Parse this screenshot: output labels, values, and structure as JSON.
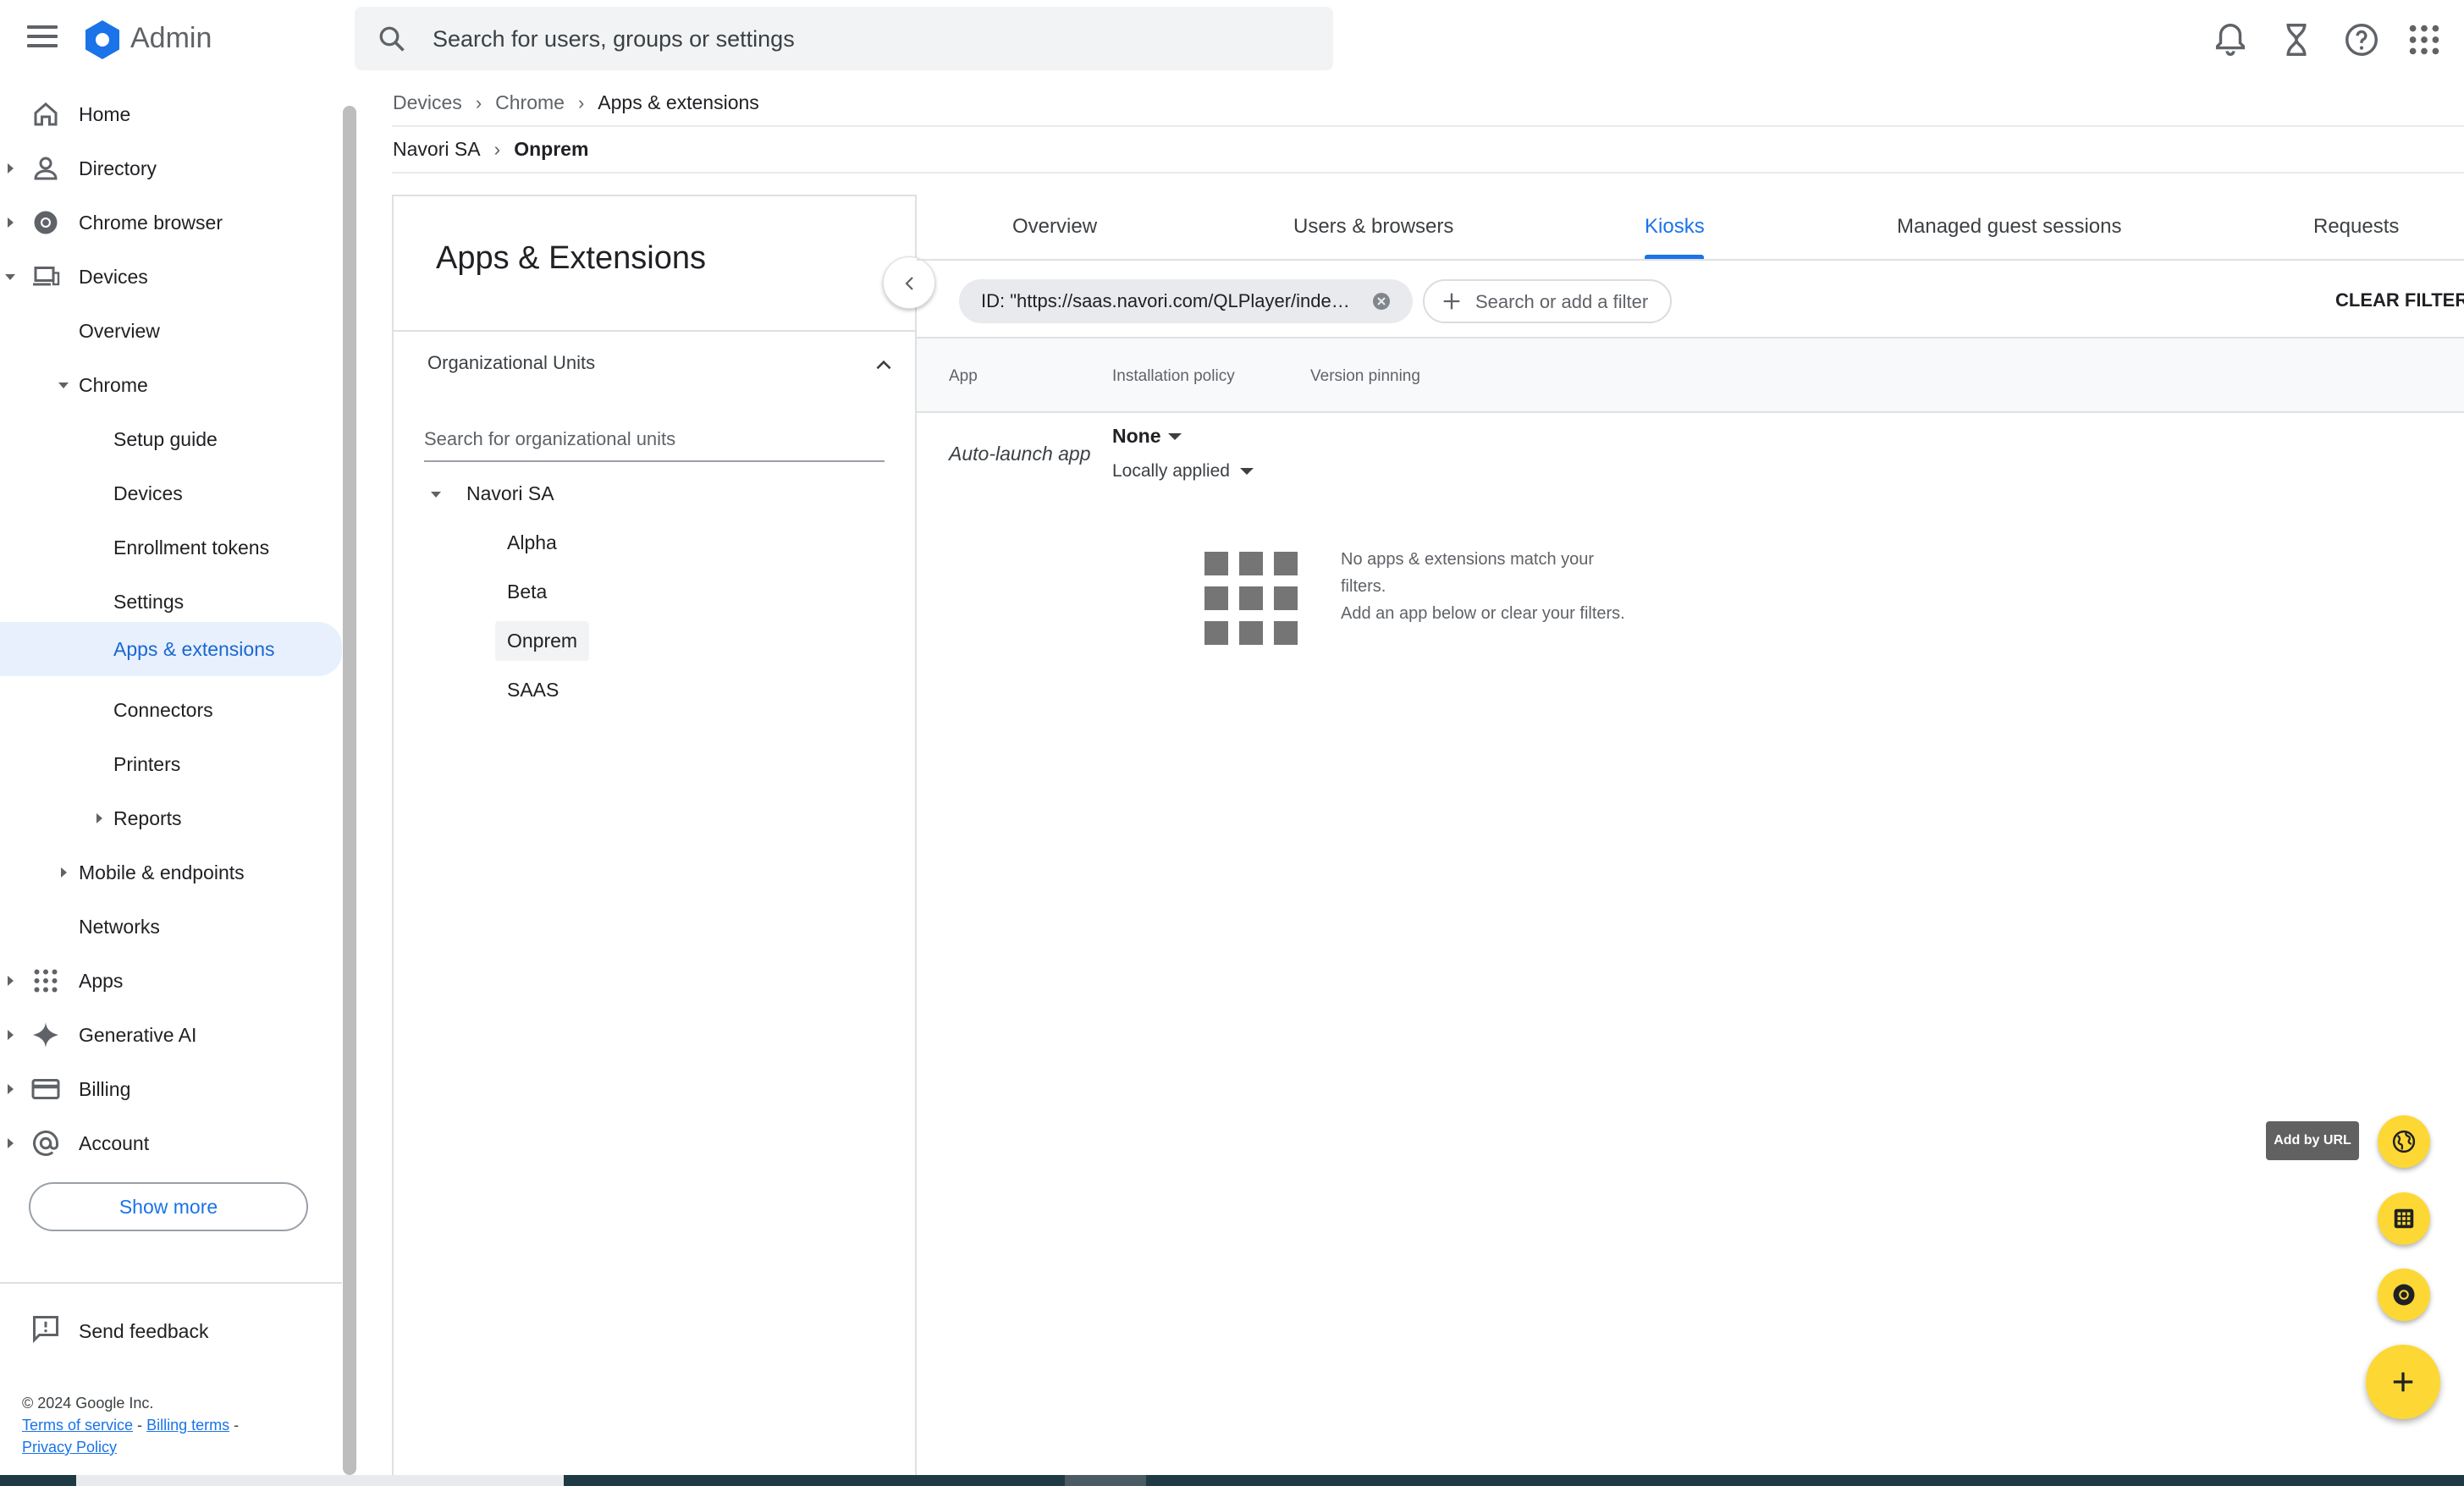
{
  "app": {
    "brand": "Admin",
    "search_placeholder": "Search for users, groups or settings"
  },
  "sidebar": {
    "items": [
      {
        "label": "Home"
      },
      {
        "label": "Directory"
      },
      {
        "label": "Chrome browser"
      },
      {
        "label": "Devices"
      },
      {
        "label": "Overview"
      },
      {
        "label": "Chrome"
      },
      {
        "label": "Setup guide"
      },
      {
        "label": "Devices"
      },
      {
        "label": "Enrollment tokens"
      },
      {
        "label": "Settings"
      },
      {
        "label": "Apps & extensions"
      },
      {
        "label": "Connectors"
      },
      {
        "label": "Printers"
      },
      {
        "label": "Reports"
      },
      {
        "label": "Mobile & endpoints"
      },
      {
        "label": "Networks"
      },
      {
        "label": "Apps"
      },
      {
        "label": "Generative AI"
      },
      {
        "label": "Billing"
      },
      {
        "label": "Account"
      }
    ],
    "show_more": "Show more",
    "send_feedback": "Send feedback",
    "copyright": "© 2024 Google Inc.",
    "terms": "Terms of service",
    "billing_terms": "Billing terms",
    "privacy": "Privacy Policy",
    "link_sep": "-"
  },
  "breadcrumb": {
    "items": [
      "Devices",
      "Chrome",
      "Apps & extensions"
    ],
    "sep": "›"
  },
  "ou_breadcrumb": {
    "items": [
      "Navori SA",
      "Onprem"
    ]
  },
  "panel": {
    "title": "Apps & Extensions",
    "ou_header": "Organizational Units",
    "ou_search_placeholder": "Search for organizational units",
    "ou_root": "Navori SA",
    "ou_children": [
      "Alpha",
      "Beta",
      "Onprem",
      "SAAS"
    ],
    "selected_ou": "Onprem"
  },
  "tabs": [
    {
      "label": "Overview"
    },
    {
      "label": "Users & browsers"
    },
    {
      "label": "Kiosks",
      "active": true
    },
    {
      "label": "Managed guest sessions"
    },
    {
      "label": "Requests"
    }
  ],
  "filters": {
    "chip": "ID: \"https://saas.navori.com/QLPlayer/inde…",
    "add_placeholder": "Search or add a filter",
    "clear": "CLEAR FILTERS"
  },
  "table": {
    "headers": [
      "App",
      "Installation policy",
      "Version pinning"
    ],
    "row": {
      "app": "Auto-launch app",
      "policy": "None",
      "applied": "Locally applied"
    },
    "empty_line1": "No apps & extensions match your filters.",
    "empty_line2": "Add an app below or clear your filters."
  },
  "fab": {
    "tooltip": "Add by URL"
  },
  "colors": {
    "accent": "#1a73e8",
    "active_bg": "#e8f0fe",
    "fab": "#fdd835"
  }
}
